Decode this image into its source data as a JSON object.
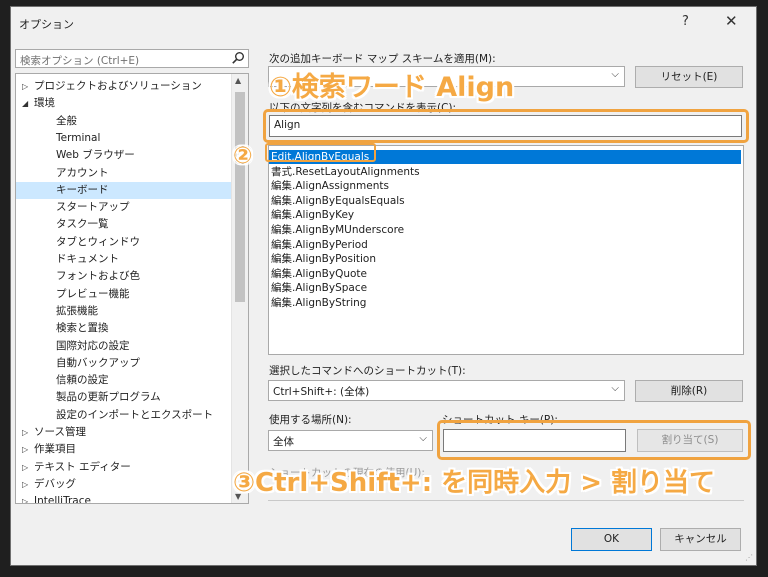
{
  "window": {
    "title": "オプション",
    "help": "?",
    "close": "✕"
  },
  "search": {
    "placeholder": "検索オプション (Ctrl+E)"
  },
  "tree": [
    {
      "label": "プロジェクトおよびソリューション",
      "level": 0,
      "expander": "▷"
    },
    {
      "label": "環境",
      "level": 0,
      "expander": "◢"
    },
    {
      "label": "全般",
      "level": 1
    },
    {
      "label": "Terminal",
      "level": 1
    },
    {
      "label": "Web ブラウザー",
      "level": 1
    },
    {
      "label": "アカウント",
      "level": 1
    },
    {
      "label": "キーボード",
      "level": 1,
      "selected": true
    },
    {
      "label": "スタートアップ",
      "level": 1
    },
    {
      "label": "タスク一覧",
      "level": 1
    },
    {
      "label": "タブとウィンドウ",
      "level": 1
    },
    {
      "label": "ドキュメント",
      "level": 1
    },
    {
      "label": "フォントおよび色",
      "level": 1
    },
    {
      "label": "プレビュー機能",
      "level": 1
    },
    {
      "label": "拡張機能",
      "level": 1
    },
    {
      "label": "検索と置換",
      "level": 1
    },
    {
      "label": "国際対応の設定",
      "level": 1
    },
    {
      "label": "自動バックアップ",
      "level": 1
    },
    {
      "label": "信頼の設定",
      "level": 1
    },
    {
      "label": "製品の更新プログラム",
      "level": 1
    },
    {
      "label": "設定のインポートとエクスポート",
      "level": 1
    },
    {
      "label": "ソース管理",
      "level": 0,
      "expander": "▷"
    },
    {
      "label": "作業項目",
      "level": 0,
      "expander": "▷"
    },
    {
      "label": "テキスト エディター",
      "level": 0,
      "expander": "▷"
    },
    {
      "label": "デバッグ",
      "level": 0,
      "expander": "▷"
    },
    {
      "label": "IntelliTrace",
      "level": 0,
      "expander": "▷"
    }
  ],
  "keyboard": {
    "scheme_label": "次の追加キーボード マップ スキームを適用(M):",
    "reset_button": "リセット(E)",
    "contains_label": "以下の文字列を含むコマンドを表示(C):",
    "filter_value": "Align",
    "commands": [
      "Edit.AlignByEquals",
      "書式.ResetLayoutAlignments",
      "編集.AlignAssignments",
      "編集.AlignByEqualsEquals",
      "編集.AlignByKey",
      "編集.AlignByMUnderscore",
      "編集.AlignByPeriod",
      "編集.AlignByPosition",
      "編集.AlignByQuote",
      "編集.AlignBySpace",
      "編集.AlignByString"
    ],
    "shortcuts_label": "選択したコマンドへのショートカット(T):",
    "shortcuts_value": "Ctrl+Shift+: (全体)",
    "remove_button": "削除(R)",
    "use_in_label": "使用する場所(N):",
    "use_in_value": "全体",
    "press_keys_label": "ショートカット キー(P):",
    "press_keys_value": "",
    "assign_button": "割り当て(S)",
    "used_by_label": "ショートカットの現在の使用(U):"
  },
  "footer": {
    "ok_button": "OK",
    "cancel_button": "キャンセル"
  },
  "annotations": {
    "step1": "①検索ワード Align",
    "step2": "②",
    "step3": "③Ctrl+Shift+: を同時入力 > 割り当て",
    "color": "#f0a340"
  }
}
